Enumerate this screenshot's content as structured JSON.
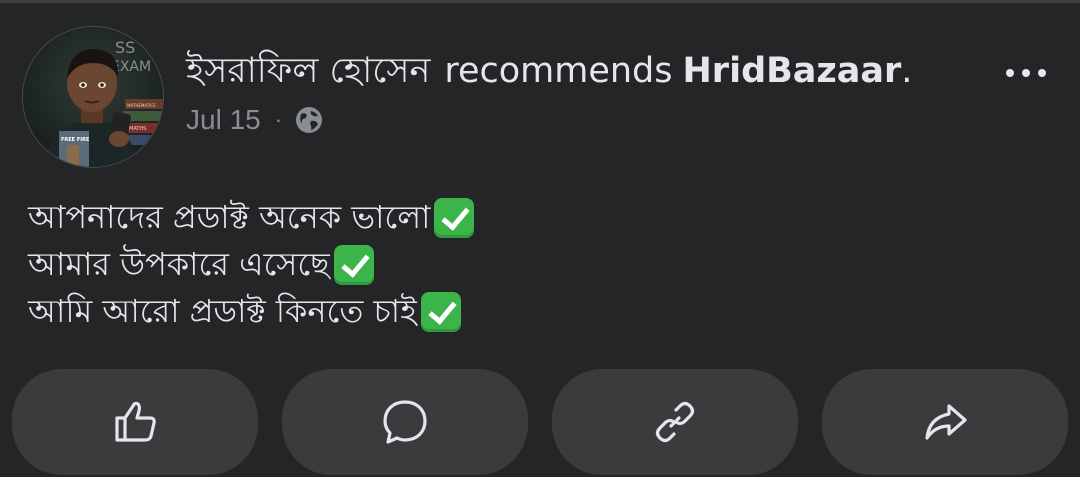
{
  "post": {
    "author_name": "ইসরাফিল হোসেন",
    "recommends_text": "recommends",
    "page_name": "HridBazaar",
    "period": ".",
    "date": "Jul 15",
    "separator": "·",
    "privacy_icon": "globe-icon",
    "more_icon": "more-options-icon",
    "avatar_text": [
      "SS",
      "EXAM",
      "FREE FIRE",
      "MATHS",
      "MATHEMATICS"
    ],
    "lines": [
      "আপনাদের প্রডাক্ট অনেক ভালো",
      "আমার উপকারে এসেছে",
      "আমি আরো প্রডাক্ট কিনতে চাই"
    ],
    "line_emoji": "check-mark-button-icon"
  },
  "actions": [
    {
      "name": "like",
      "icon": "thumbs-up-icon"
    },
    {
      "name": "comment",
      "icon": "comment-icon"
    },
    {
      "name": "copy-link",
      "icon": "link-icon"
    },
    {
      "name": "share",
      "icon": "share-icon"
    }
  ],
  "colors": {
    "background": "#242526",
    "text": "#e4e6eb",
    "secondary_text": "#8a8d91",
    "button_bg": "#3a3b3c",
    "check_green": "#3bb44a"
  }
}
